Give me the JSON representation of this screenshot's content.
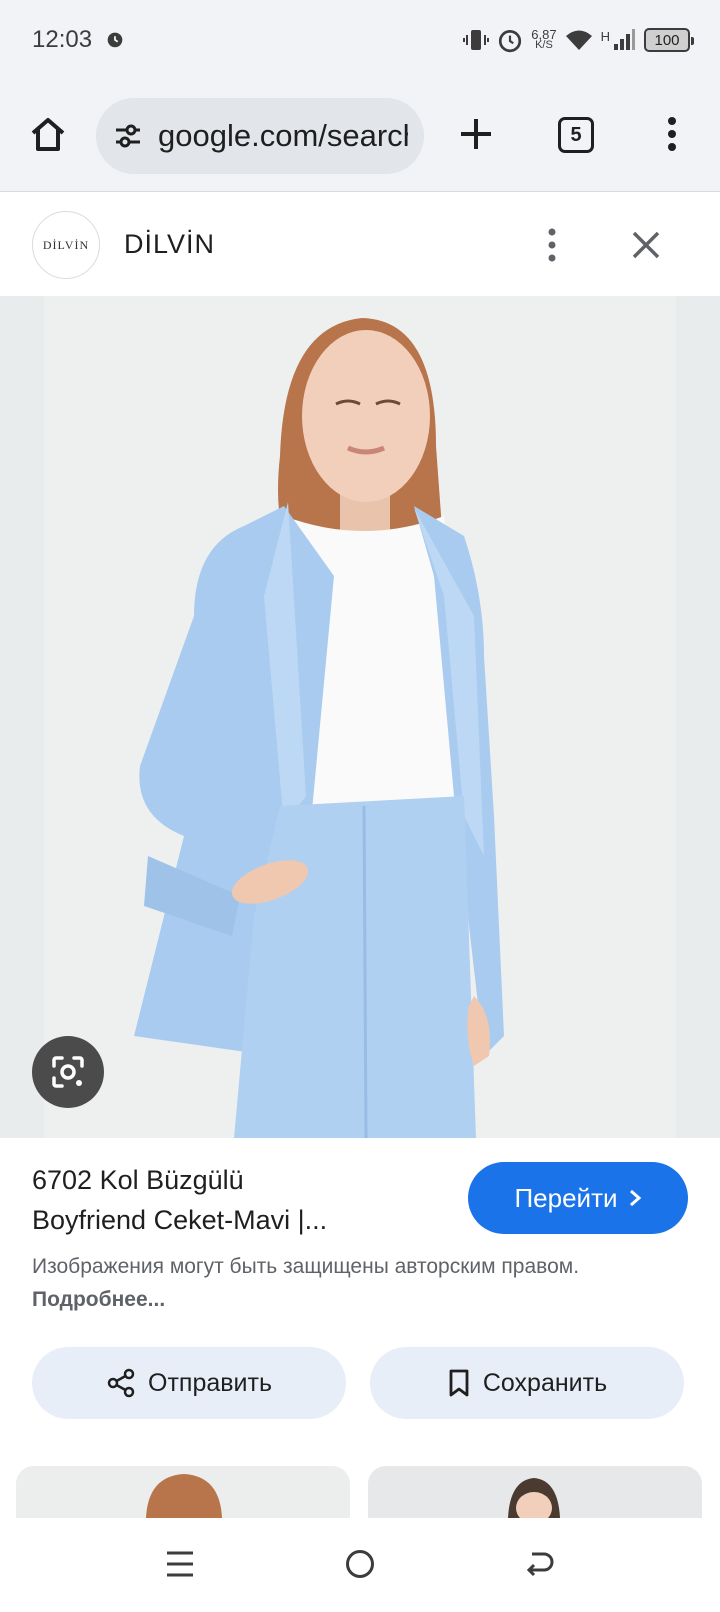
{
  "status_bar": {
    "time": "12:03",
    "speed_value": "6,87",
    "speed_unit": "K/S",
    "network_type": "H",
    "battery": "100"
  },
  "browser": {
    "url": "google.com/search",
    "tab_count": "5"
  },
  "source": {
    "logo_text": "DİLVİN",
    "site_name": "DİLVİN"
  },
  "result": {
    "title_line1": "6702 Kol Büzgülü",
    "title_line2": "Boyfriend Ceket-Mavi |...",
    "visit_label": "Перейти",
    "copyright_text": "Изображения могут быть защищены авторским правом.",
    "more_link": "Подробнее..."
  },
  "actions": {
    "share_label": "Отправить",
    "save_label": "Сохранить"
  },
  "colors": {
    "accent": "#1a73e8",
    "jacket": "#a9cbef",
    "toolbar_bg": "#f1f3f6"
  }
}
